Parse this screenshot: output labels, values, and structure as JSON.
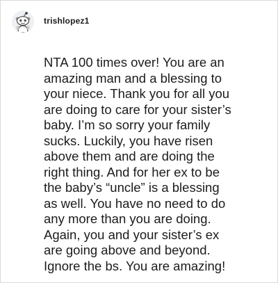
{
  "comment": {
    "author": {
      "username": "trishlopez1",
      "avatar_icon": "snoo-avatar-icon"
    },
    "body": "NTA 100 times over! You are an\namazing man and a blessing to\nyour niece. Thank you for all you\nare doing to care for your sister’s\nbaby. I’m so sorry your family\nsucks. Luckily, you have risen\nabove them and are doing the\nright thing. And for her ex to be\nthe baby’s “uncle” is a blessing\nas well. You have no need to do\nany more than you are doing.\nAgain, you and your sister’s ex\nare going above and beyond.\nIgnore the bs. You are amazing!"
  },
  "colors": {
    "text": "#1c1c1c",
    "border": "#d9d9d9",
    "background": "#ffffff"
  }
}
